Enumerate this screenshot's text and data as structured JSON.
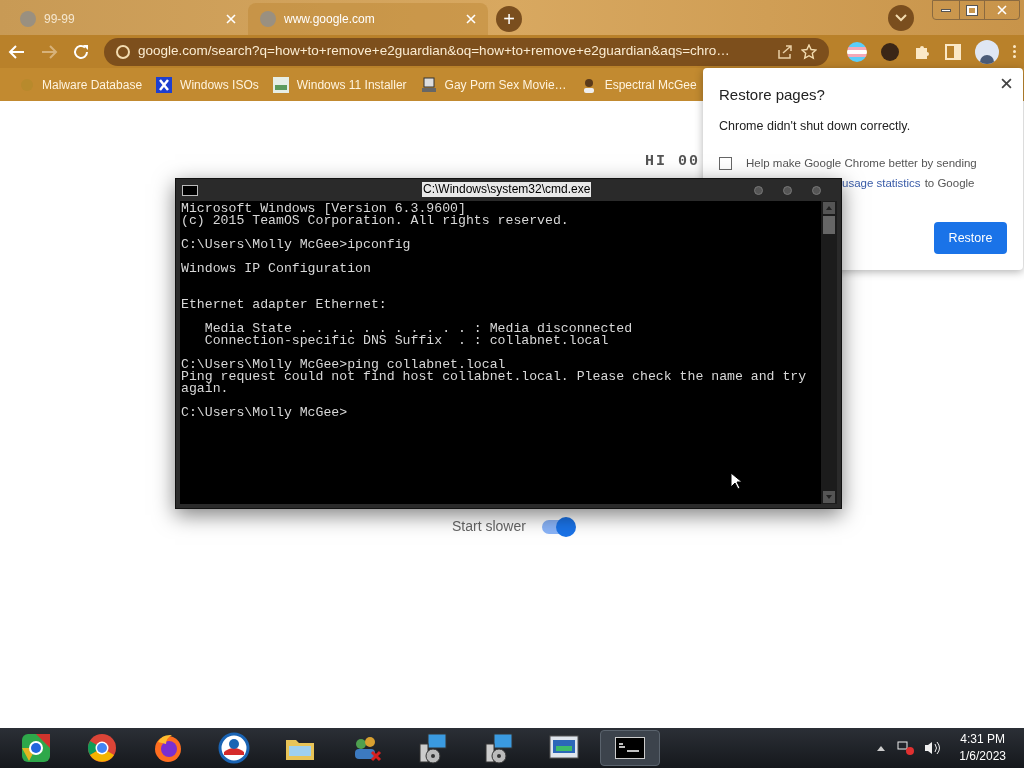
{
  "browser": {
    "tabs": [
      {
        "title": "99-99",
        "selected": false
      },
      {
        "title": "www.google.com",
        "selected": true
      }
    ],
    "new_tab": "+",
    "address": "google.com/search?q=how+to+remove+e2guardian&oq=how+to+remove+e2guardian&aqs=chro…",
    "bookmarks": [
      {
        "label": "Malware Database",
        "kind": "plain"
      },
      {
        "label": "Windows ISOs",
        "kind": "x"
      },
      {
        "label": "Windows 11 Installer",
        "kind": "image"
      },
      {
        "label": "Gay Porn Sex Movie…",
        "kind": "computer"
      },
      {
        "label": "Espectral McGee",
        "kind": "person"
      }
    ]
  },
  "page": {
    "heading": "HI 00",
    "toggle": {
      "label": "Start slower",
      "on": true
    }
  },
  "restore_popup": {
    "title": "Restore pages?",
    "message": "Chrome didn't shut down correctly.",
    "checkbox": {
      "text_before": "Help make Google Chrome better by sending",
      "link": "usage statistics",
      "text_after": "to Google",
      "checked": false
    },
    "button": "Restore"
  },
  "console": {
    "title": "C:\\Windows\\system32\\cmd.exe",
    "lines": [
      {
        "kind": "text",
        "text": "Microsoft Windows [Version 6.3.9600]"
      },
      {
        "kind": "text",
        "text": "(c) 2015 TeamOS Corporation. All rights reserved."
      },
      {
        "kind": "blank"
      },
      {
        "kind": "text",
        "text": "C:\\Users\\Molly McGee>ipconfig"
      },
      {
        "kind": "blank"
      },
      {
        "kind": "text",
        "text": "Windows IP Configuration"
      },
      {
        "kind": "blank"
      },
      {
        "kind": "blank"
      },
      {
        "kind": "text",
        "text": "Ethernet adapter Ethernet:"
      },
      {
        "kind": "blank"
      },
      {
        "kind": "text",
        "text": "   Media State . . . . . . . . . . . : Media disconnected"
      },
      {
        "kind": "text",
        "text": "   Connection-specific DNS Suffix  . : collabnet.local"
      },
      {
        "kind": "blank"
      },
      {
        "kind": "text",
        "text": "C:\\Users\\Molly McGee>ping collabnet.local"
      },
      {
        "kind": "text",
        "text": "Ping request could not find host collabnet.local. Please check the name and try"
      },
      {
        "kind": "text",
        "text": "again."
      },
      {
        "kind": "blank"
      },
      {
        "kind": "text",
        "text": "C:\\Users\\Molly McGee>"
      }
    ]
  },
  "taskbar": {
    "apps": [
      {
        "kind": "chromium",
        "active": false
      },
      {
        "kind": "chrome",
        "active": false
      },
      {
        "kind": "firefox",
        "active": false
      },
      {
        "kind": "ring",
        "active": false
      },
      {
        "kind": "folder",
        "active": false
      },
      {
        "kind": "people",
        "active": false
      },
      {
        "kind": "installer",
        "active": false
      },
      {
        "kind": "installer",
        "active": false
      },
      {
        "kind": "monitor",
        "active": false
      },
      {
        "kind": "terminal",
        "active": true
      }
    ],
    "time": "4:31 PM",
    "date": "1/6/2023"
  }
}
